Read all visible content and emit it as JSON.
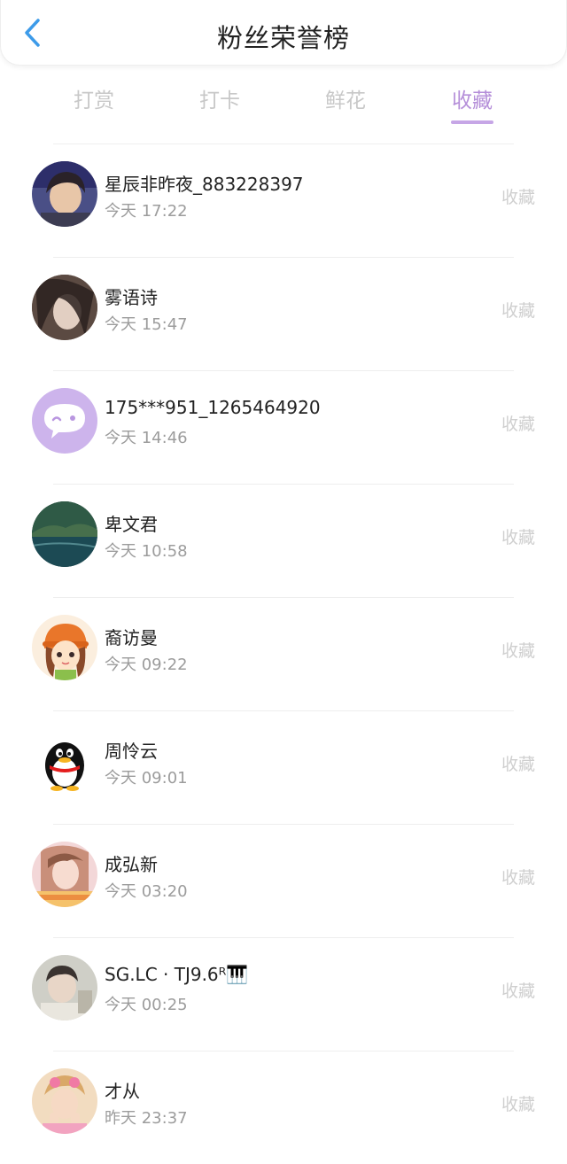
{
  "header": {
    "title": "粉丝荣誉榜"
  },
  "tabs": [
    {
      "label": "打赏",
      "active": false
    },
    {
      "label": "打卡",
      "active": false
    },
    {
      "label": "鲜花",
      "active": false
    },
    {
      "label": "收藏",
      "active": true
    }
  ],
  "colors": {
    "accent": "#b58fd9",
    "back_arrow": "#3d9be9"
  },
  "rows": [
    {
      "name": "星辰非昨夜_883228397",
      "time": "今天 17:22",
      "action": "收藏",
      "avatar_icon": "photo-avatar"
    },
    {
      "name": "雾语诗",
      "time": "今天 15:47",
      "action": "收藏",
      "avatar_icon": "photo-avatar"
    },
    {
      "name": "175***951_1265464920",
      "time": "今天 14:46",
      "action": "收藏",
      "avatar_icon": "chat-bubble-avatar"
    },
    {
      "name": "卑文君",
      "time": "今天 10:58",
      "action": "收藏",
      "avatar_icon": "landscape-avatar"
    },
    {
      "name": "裔访曼",
      "time": "今天 09:22",
      "action": "收藏",
      "avatar_icon": "cartoon-girl-avatar"
    },
    {
      "name": "周怜云",
      "time": "今天 09:01",
      "action": "收藏",
      "avatar_icon": "penguin-avatar"
    },
    {
      "name": "成弘新",
      "time": "今天 03:20",
      "action": "收藏",
      "avatar_icon": "photo-avatar"
    },
    {
      "name": "SG.LC · TJ9.6ᴿ🎹",
      "time": "今天 00:25",
      "action": "收藏",
      "avatar_icon": "photo-avatar"
    },
    {
      "name": "才从",
      "time": "昨天 23:37",
      "action": "收藏",
      "avatar_icon": "photo-avatar"
    }
  ]
}
